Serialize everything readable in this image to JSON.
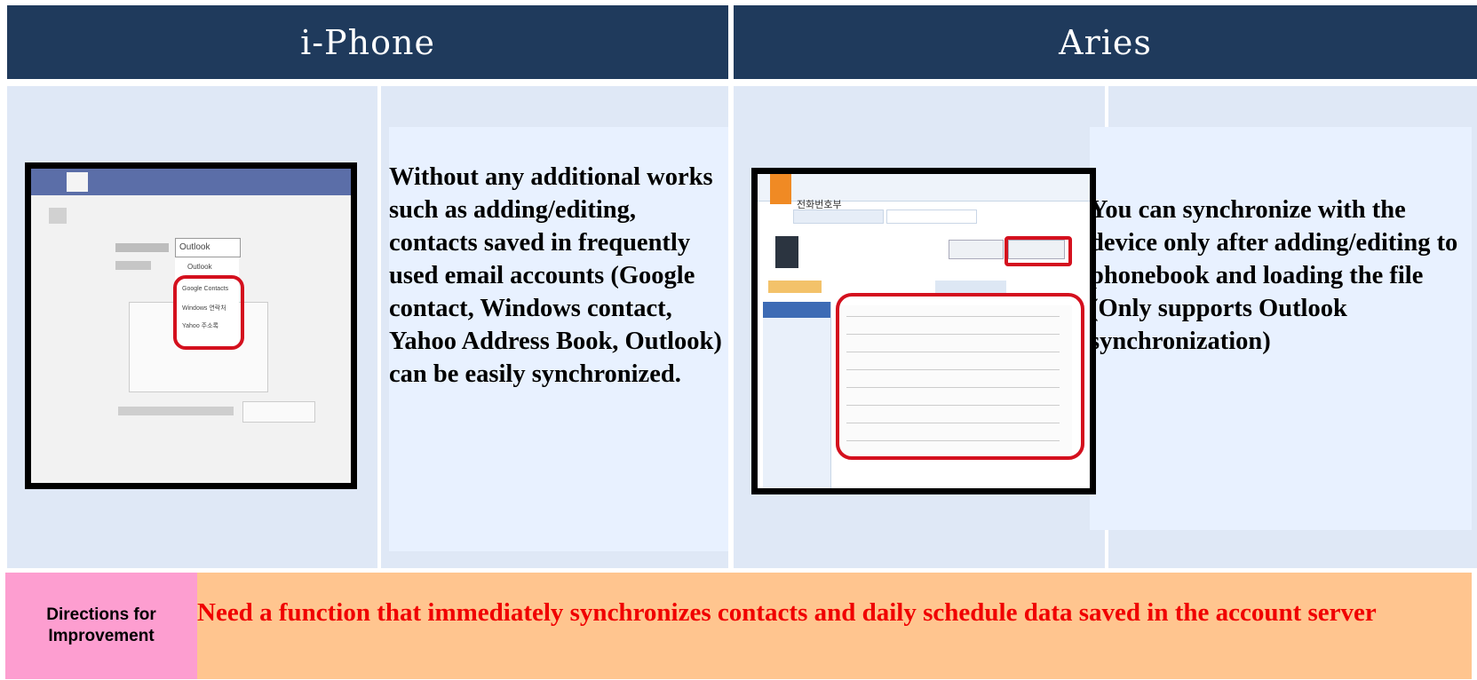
{
  "headers": {
    "left": "i-Phone",
    "right": "Aries"
  },
  "iphone": {
    "description": "Without any additional works such as adding/editing, contacts saved in frequently used email accounts (Google contact, Windows contact, Yahoo Address Book, Outlook) can be easily synchronized.",
    "screenshot": {
      "dropdown_value": "Outlook",
      "menu_items": [
        "Outlook",
        "Google Contacts",
        "Windows 연락처",
        "Yahoo 주소록"
      ],
      "icon": "mock-settings-screenshot"
    }
  },
  "aries": {
    "description_line1": "You can synchronize with the device only after adding/editing to phonebook and loading the file",
    "description_line2": "(Only supports Outlook synchronization)",
    "screenshot": {
      "title": "전화번호부",
      "icon": "mock-phonebook-screenshot"
    }
  },
  "improvement": {
    "label": "Directions for Improvement",
    "text": "Need a function that immediately synchronizes contacts and daily schedule data saved in the account server"
  },
  "colors": {
    "header": "#1f3a5c",
    "cell": "#dfe8f6",
    "label_bg": "#fd9ed0",
    "text_bg": "#ffc58f",
    "accent_red": "#f00000"
  }
}
